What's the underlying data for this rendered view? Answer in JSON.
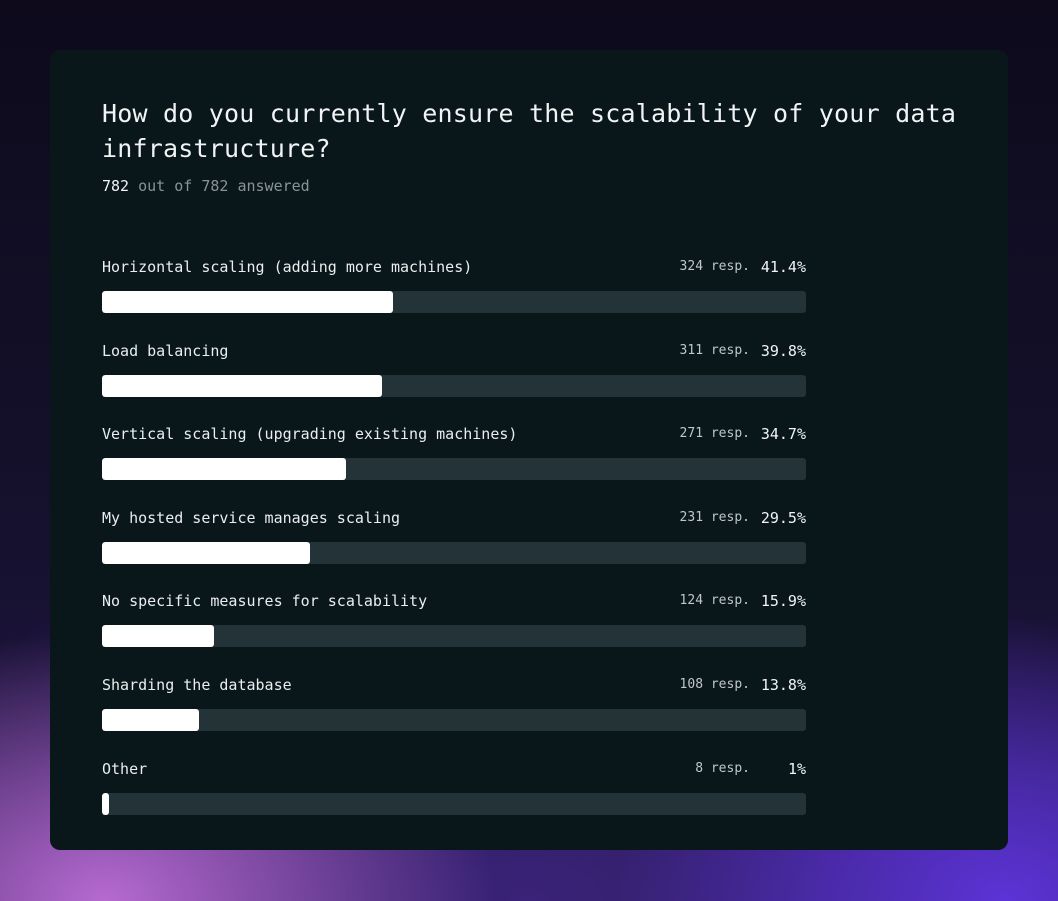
{
  "survey": {
    "question": "How do you currently ensure the scalability of your data infrastructure?",
    "answered_count": "782",
    "answered_suffix": " out of 782 answered"
  },
  "colors": {
    "bar_fill": "#ffffff",
    "bar_track": "#243337",
    "card_background": "#09161a"
  },
  "chart_data": {
    "type": "bar",
    "orientation": "horizontal",
    "title": "How do you currently ensure the scalability of your data infrastructure?",
    "categories": [
      "Horizontal scaling (adding more machines)",
      "Load balancing",
      "Vertical scaling (upgrading existing machines)",
      "My hosted service manages scaling",
      "No specific measures for scalability",
      "Sharding the database",
      "Other"
    ],
    "responses": [
      324,
      311,
      271,
      231,
      124,
      108,
      8
    ],
    "values": [
      41.4,
      39.8,
      34.7,
      29.5,
      15.9,
      13.8,
      1
    ],
    "response_labels": [
      "324 resp.",
      "311 resp.",
      "271 resp.",
      "231 resp.",
      "124 resp.",
      "108 resp.",
      "8 resp."
    ],
    "percent_labels": [
      "41.4%",
      "39.8%",
      "34.7%",
      "29.5%",
      "15.9%",
      "13.8%",
      "1%"
    ],
    "xlim": [
      0,
      100
    ],
    "grid": false,
    "legend": "none"
  }
}
